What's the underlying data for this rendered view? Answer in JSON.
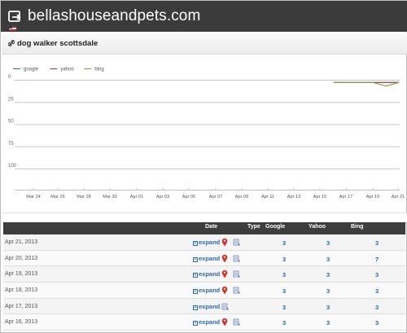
{
  "site": {
    "title": "bellashouseandpets.com",
    "flag_icon": "us-flag-icon"
  },
  "keyword": {
    "label": "dog walker scottsdale",
    "icon": "link-icon"
  },
  "chart_data": {
    "type": "line",
    "y_tick_labels": [
      "0",
      "25",
      "50",
      "75",
      "100"
    ],
    "ylim": [
      0,
      115
    ],
    "y_inverted": true,
    "x_tick_labels": [
      "Mar 24",
      "Mar 26",
      "Mar 28",
      "Mar 30",
      "Apr 01",
      "Apr 03",
      "Apr 05",
      "Apr 07",
      "Apr 09",
      "Apr 11",
      "Apr 13",
      "Apr 15",
      "Apr 17",
      "Apr 19",
      "Apr 21"
    ],
    "grid": true,
    "legend_position": "top-left",
    "series": [
      {
        "name": "google",
        "color": "#4572a7",
        "x": [
          "Apr 16",
          "Apr 17",
          "Apr 18",
          "Apr 19",
          "Apr 20",
          "Apr 21"
        ],
        "values": [
          3,
          3,
          3,
          3,
          3,
          3
        ]
      },
      {
        "name": "yahoo",
        "color": "#aa4643",
        "x": [
          "Apr 16",
          "Apr 17",
          "Apr 18",
          "Apr 19",
          "Apr 20",
          "Apr 21"
        ],
        "values": [
          3,
          3,
          3,
          3,
          3,
          3
        ]
      },
      {
        "name": "bing",
        "color": "#89a54e",
        "x": [
          "Apr 16",
          "Apr 17",
          "Apr 18",
          "Apr 19",
          "Apr 20",
          "Apr 21"
        ],
        "values": [
          3,
          3,
          3,
          3,
          7,
          3
        ]
      }
    ]
  },
  "table": {
    "headers": {
      "date": "Date",
      "type": "Type",
      "google": "Google",
      "yahoo": "Yahoo",
      "bing": "Bing"
    },
    "expand_label": "expand",
    "expand_symbol": "+",
    "rows": [
      {
        "date": "Apr 21, 2013",
        "has_pin": true,
        "google": "3",
        "yahoo": "3",
        "bing": "3"
      },
      {
        "date": "Apr 20, 2013",
        "has_pin": true,
        "google": "3",
        "yahoo": "3",
        "bing": "7"
      },
      {
        "date": "Apr 19, 2013",
        "has_pin": true,
        "google": "3",
        "yahoo": "3",
        "bing": "3"
      },
      {
        "date": "Apr 18, 2013",
        "has_pin": true,
        "google": "3",
        "yahoo": "3",
        "bing": "3"
      },
      {
        "date": "Apr 17, 2013",
        "has_pin": false,
        "google": "3",
        "yahoo": "3",
        "bing": "3"
      },
      {
        "date": "Apr 16, 2013",
        "has_pin": true,
        "google": "3",
        "yahoo": "3",
        "bing": "3"
      }
    ]
  }
}
